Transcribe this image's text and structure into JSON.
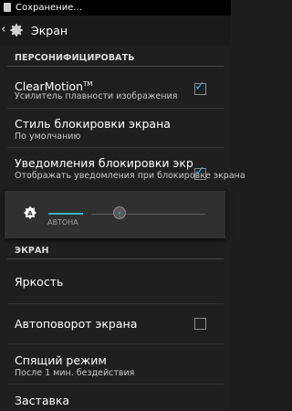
{
  "status_bar": {
    "text": "Сохранение..."
  },
  "action_bar": {
    "back_glyph": "‹",
    "title": "Экран"
  },
  "sections": {
    "personalize": "ПЕРСОНИФИЦИРОВАТЬ",
    "screen": "ЭКРАН"
  },
  "items": {
    "clearmotion": {
      "title": "ClearMotion",
      "tm": "TM",
      "subtitle": "Усилитель плавности изображения",
      "checked": true
    },
    "lock_style": {
      "title": "Стиль блокировки экрана",
      "subtitle": "По умолчанию"
    },
    "lock_notifications": {
      "title": "Уведомления блокировки экр",
      "subtitle": "Отображать уведомления при блокировке экрана",
      "checked": true
    },
    "brightness": {
      "title": "Яркость"
    },
    "autorotate": {
      "title": "Автоповорот экрана",
      "checked": false
    },
    "sleep": {
      "title": "Спящий режим",
      "subtitle": "После 1 мин. бездействия"
    },
    "screensaver": {
      "title": "Заставка"
    }
  },
  "brightness_popup": {
    "auto_label": "АВТОНА",
    "level": 0.22
  },
  "colors": {
    "accent": "#33b5e5",
    "background": "#1f1f1f"
  }
}
